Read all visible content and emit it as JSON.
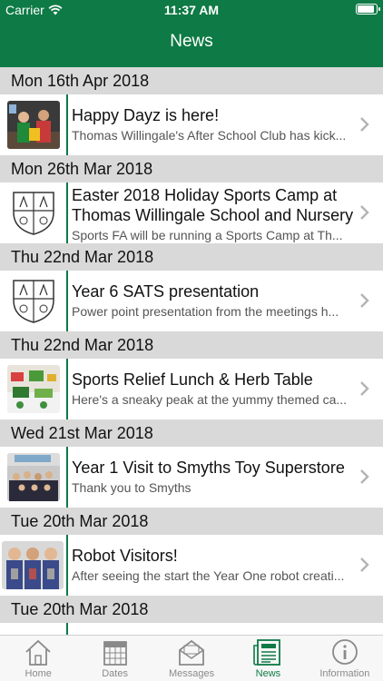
{
  "status_bar": {
    "carrier": "Carrier",
    "time": "11:37 AM"
  },
  "nav": {
    "title": "News"
  },
  "sections": [
    {
      "date": "Mon 16th Apr 2018",
      "item": {
        "title": "Happy Dayz is here!",
        "snippet": "Thomas Willingale's After School Club has kick...",
        "thumb": "photo-children"
      }
    },
    {
      "date": "Mon 26th Mar 2018",
      "item": {
        "title": "Easter 2018 Holiday Sports Camp at Thomas Willingale School and Nursery",
        "snippet": "Sports FA will be running a Sports Camp at Th...",
        "thumb": "school-crest"
      }
    },
    {
      "date": "Thu 22nd Mar 2018",
      "item": {
        "title": "Year 6 SATS presentation",
        "snippet": "Power point presentation from the meetings h...",
        "thumb": "school-crest"
      }
    },
    {
      "date": "Thu 22nd Mar 2018",
      "item": {
        "title": "Sports Relief Lunch & Herb Table",
        "snippet": "Here's a sneaky peak at the yummy themed ca...",
        "thumb": "photo-table"
      }
    },
    {
      "date": "Wed 21st Mar 2018",
      "item": {
        "title": "Year 1 Visit to Smyths Toy Superstore",
        "snippet": "Thank you to Smyths",
        "thumb": "photo-class"
      }
    },
    {
      "date": "Tue 20th Mar 2018",
      "item": {
        "title": "Robot Visitors!",
        "snippet": "After seeing the start the Year One robot creati...",
        "thumb": "photo-robots"
      }
    },
    {
      "date": "Tue 20th Mar 2018"
    }
  ],
  "tabs": [
    {
      "label": "Home",
      "icon": "home-icon",
      "active": false
    },
    {
      "label": "Dates",
      "icon": "calendar-icon",
      "active": false
    },
    {
      "label": "Messages",
      "icon": "envelope-icon",
      "active": false
    },
    {
      "label": "News",
      "icon": "newspaper-icon",
      "active": true
    },
    {
      "label": "Information",
      "icon": "info-icon",
      "active": false
    }
  ],
  "colors": {
    "brand": "#0e7a45",
    "section_bg": "#d9d9d9",
    "tab_inactive": "#8a8a8a"
  }
}
